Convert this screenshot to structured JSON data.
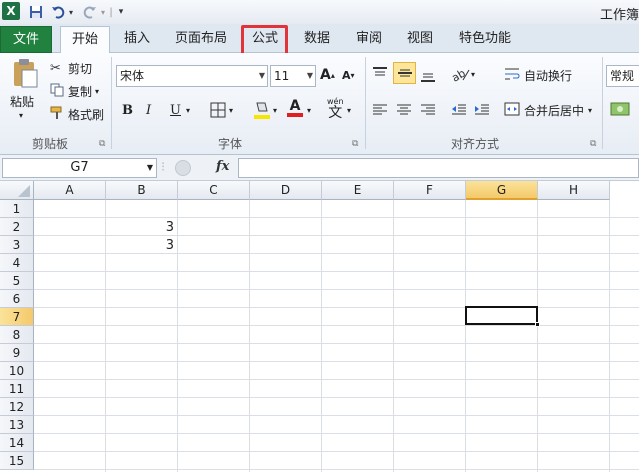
{
  "window": {
    "title": "工作簿",
    "app_icon": "X"
  },
  "tabs": [
    {
      "label": "文件"
    },
    {
      "label": "开始"
    },
    {
      "label": "插入"
    },
    {
      "label": "页面布局"
    },
    {
      "label": "公式"
    },
    {
      "label": "数据"
    },
    {
      "label": "审阅"
    },
    {
      "label": "视图"
    },
    {
      "label": "特色功能"
    }
  ],
  "ribbon": {
    "clipboard": {
      "paste": "粘贴",
      "cut": "剪切",
      "copy": "复制",
      "format_painter": "格式刷",
      "group_label": "剪贴板"
    },
    "font": {
      "font_name": "宋体",
      "font_size": "11",
      "bold": "B",
      "italic": "I",
      "underline": "U",
      "wen": "wén",
      "wen_char": "文",
      "group_label": "字体"
    },
    "alignment": {
      "wrap_text": "自动换行",
      "merge_center": "合并后居中",
      "group_label": "对齐方式"
    },
    "number": {
      "format": "常规"
    }
  },
  "formula_bar": {
    "name_box": "G7",
    "fx": "fx",
    "formula": ""
  },
  "sheet": {
    "columns": [
      "A",
      "B",
      "C",
      "D",
      "E",
      "F",
      "G",
      "H"
    ],
    "rows": [
      "1",
      "2",
      "3",
      "4",
      "5",
      "6",
      "7",
      "8",
      "9",
      "10",
      "11",
      "12",
      "13",
      "14",
      "15"
    ],
    "selected_cell": "G7",
    "cells": {
      "B2": "3",
      "B3": "3"
    }
  },
  "colors": {
    "file_tab": "#21813f",
    "highlight_box": "#e0343a",
    "selected_header": "#f4c96a"
  }
}
